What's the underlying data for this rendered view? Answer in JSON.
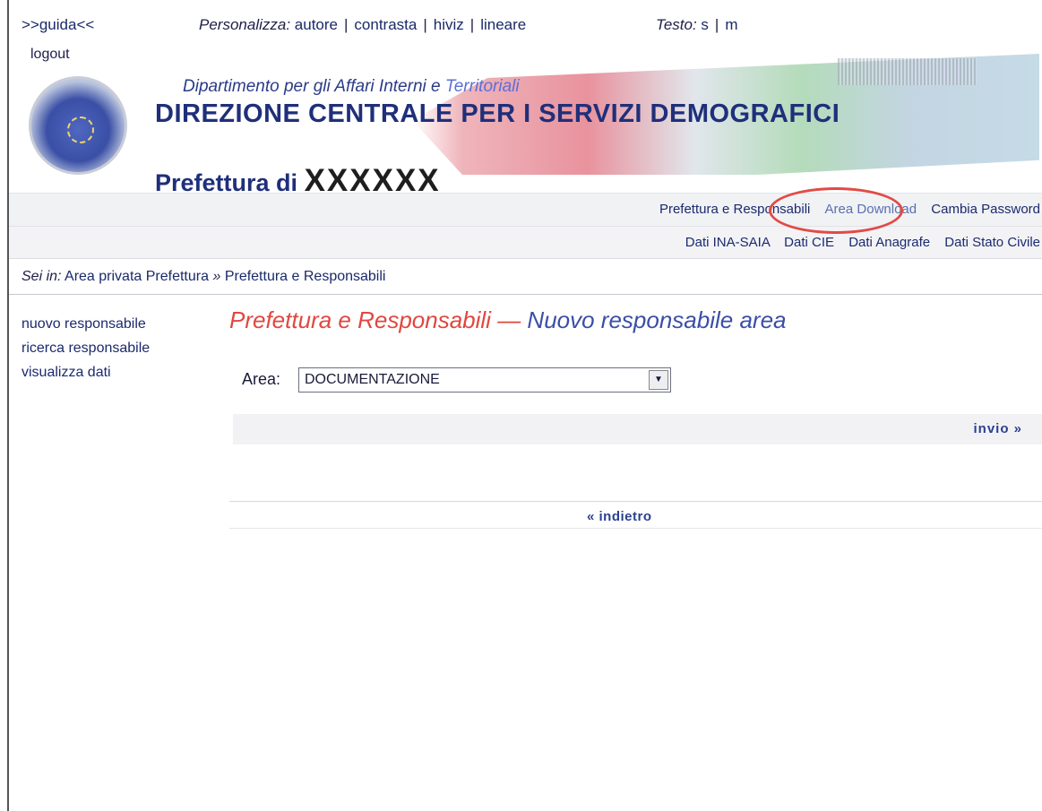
{
  "util": {
    "guida": ">>guida<<",
    "personalizza_label": "Personalizza:",
    "personalizza_items": [
      "autore",
      "contrasta",
      "hiviz",
      "lineare"
    ],
    "testo_label": "Testo:",
    "testo_items": [
      "s",
      "m"
    ],
    "logout": "logout"
  },
  "header": {
    "dept_main": "Dipartimento per gli Affari Interni e",
    "dept_terr": "Territoriali",
    "direzione": "DIREZIONE CENTRALE PER I SERVIZI DEMOGRAFICI",
    "prefettura_label": "Prefettura di",
    "prefettura_name": "XXXXXX"
  },
  "nav1": [
    "Prefettura e Responsabili",
    "Area Download",
    "Cambia Password"
  ],
  "nav2": [
    "Dati INA-SAIA",
    "Dati CIE",
    "Dati Anagrafe",
    "Dati Stato Civile"
  ],
  "breadcrumb": {
    "label": "Sei in:",
    "item1": "Area privata Prefettura",
    "sep": "»",
    "item2": "Prefettura e Responsabili"
  },
  "leftmenu": [
    "nuovo responsabile",
    "ricerca responsabile",
    "visualizza dati"
  ],
  "heading": {
    "part1": "Prefettura e Responsabili",
    "dash": "—",
    "part2": "Nuovo responsabile area"
  },
  "form": {
    "area_label": "Area:",
    "area_value": "DOCUMENTAZIONE",
    "submit": "invio »",
    "back": "« indietro"
  },
  "colors": {
    "accent_red": "#e0473f",
    "accent_blue": "#3a4ea8",
    "link": "#1b2a6e",
    "highlight_circle": "#e14b46"
  }
}
